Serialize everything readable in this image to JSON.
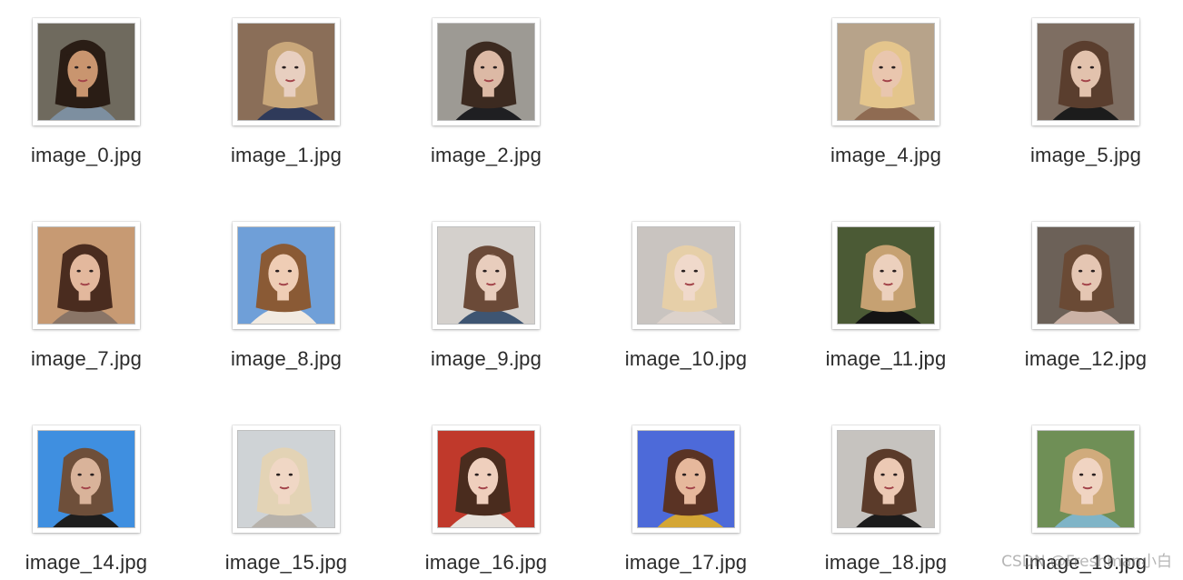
{
  "window": {
    "view": "icon-grid"
  },
  "files": [
    {
      "name": "image_0.jpg",
      "col": 0,
      "row": 0,
      "colors": {
        "bg": "#6f6a5e",
        "hair": "#2a1d15",
        "skin": "#c9956f",
        "cloth": "#7d8fa0"
      }
    },
    {
      "name": "image_1.jpg",
      "col": 1,
      "row": 0,
      "colors": {
        "bg": "#8a6e58",
        "hair": "#c9a77a",
        "skin": "#e8cfc0",
        "cloth": "#2f3a5a"
      }
    },
    {
      "name": "image_2.jpg",
      "col": 2,
      "row": 0,
      "colors": {
        "bg": "#9d9a94",
        "hair": "#3c2a20",
        "skin": "#dcb9a5",
        "cloth": "#1f1f22"
      }
    },
    {
      "name": "image_4.jpg",
      "col": 4,
      "row": 0,
      "colors": {
        "bg": "#b7a38a",
        "hair": "#e4c58c",
        "skin": "#e9c6ae",
        "cloth": "#8f6b52"
      }
    },
    {
      "name": "image_5.jpg",
      "col": 5,
      "row": 0,
      "colors": {
        "bg": "#7e6e62",
        "hair": "#5a3e2e",
        "skin": "#e2c2ad",
        "cloth": "#1c1c1c"
      }
    },
    {
      "name": "image_7.jpg",
      "col": 0,
      "row": 1,
      "colors": {
        "bg": "#c79a73",
        "hair": "#4a2c1f",
        "skin": "#e3b89d",
        "cloth": "#8a7567"
      }
    },
    {
      "name": "image_8.jpg",
      "col": 1,
      "row": 1,
      "colors": {
        "bg": "#6f9fd8",
        "hair": "#8a5a35",
        "skin": "#efcdb5",
        "cloth": "#f2ebe2"
      }
    },
    {
      "name": "image_9.jpg",
      "col": 2,
      "row": 1,
      "colors": {
        "bg": "#d4d0cc",
        "hair": "#6b4a38",
        "skin": "#e8cdbd",
        "cloth": "#3e5572"
      }
    },
    {
      "name": "image_10.jpg",
      "col": 3,
      "row": 1,
      "colors": {
        "bg": "#c9c4c0",
        "hair": "#e6cfa8",
        "skin": "#f0d9cb",
        "cloth": "#dcd2cb"
      }
    },
    {
      "name": "image_11.jpg",
      "col": 4,
      "row": 1,
      "colors": {
        "bg": "#4b5a35",
        "hair": "#c6a172",
        "skin": "#ecd0bd",
        "cloth": "#141414"
      }
    },
    {
      "name": "image_12.jpg",
      "col": 5,
      "row": 1,
      "colors": {
        "bg": "#6c6158",
        "hair": "#6a4a35",
        "skin": "#e5c6b3",
        "cloth": "#cbb2a6"
      }
    },
    {
      "name": "image_14.jpg",
      "col": 0,
      "row": 2,
      "colors": {
        "bg": "#3f8fe0",
        "hair": "#6e4f3a",
        "skin": "#d9b39a",
        "cloth": "#1d1d1d"
      }
    },
    {
      "name": "image_15.jpg",
      "col": 1,
      "row": 2,
      "colors": {
        "bg": "#cfd3d6",
        "hair": "#e3d3b5",
        "skin": "#f0d7c5",
        "cloth": "#b7b2ab"
      }
    },
    {
      "name": "image_16.jpg",
      "col": 2,
      "row": 2,
      "colors": {
        "bg": "#c0392b",
        "hair": "#4a2c1e",
        "skin": "#efcfbd",
        "cloth": "#e7e2dc"
      }
    },
    {
      "name": "image_17.jpg",
      "col": 3,
      "row": 2,
      "colors": {
        "bg": "#4d6ad9",
        "hair": "#5a3324",
        "skin": "#e6b89c",
        "cloth": "#d4a635"
      }
    },
    {
      "name": "image_18.jpg",
      "col": 4,
      "row": 2,
      "colors": {
        "bg": "#c6c3bf",
        "hair": "#5b3b2a",
        "skin": "#ecc9b4",
        "cloth": "#1b1b1b"
      }
    },
    {
      "name": "image_19.jpg",
      "col": 5,
      "row": 2,
      "colors": {
        "bg": "#6f8f56",
        "hair": "#d0ab7c",
        "skin": "#f0d4c2",
        "cloth": "#7fb4c7"
      }
    }
  ],
  "watermark": "CSDN @Freshman小白"
}
